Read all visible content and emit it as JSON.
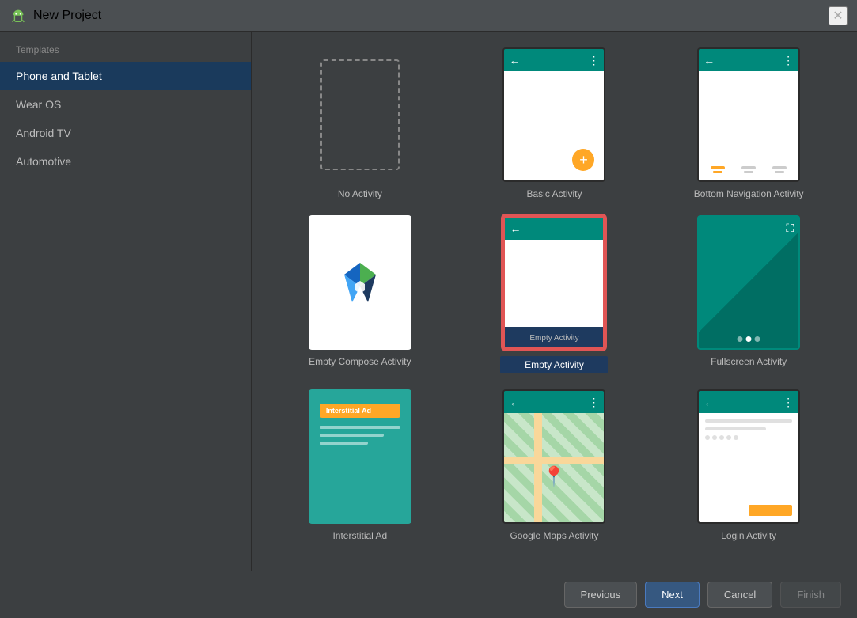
{
  "window": {
    "title": "New Project",
    "close_icon": "✕"
  },
  "sidebar": {
    "section_label": "Templates",
    "items": [
      {
        "id": "phone-tablet",
        "label": "Phone and Tablet",
        "active": true
      },
      {
        "id": "wear-os",
        "label": "Wear OS",
        "active": false
      },
      {
        "id": "android-tv",
        "label": "Android TV",
        "active": false
      },
      {
        "id": "automotive",
        "label": "Automotive",
        "active": false
      }
    ]
  },
  "templates": {
    "items": [
      {
        "id": "no-activity",
        "label": "No Activity",
        "selected": false
      },
      {
        "id": "basic-activity",
        "label": "Basic Activity",
        "selected": false
      },
      {
        "id": "bottom-navigation",
        "label": "Bottom Navigation Activity",
        "selected": false
      },
      {
        "id": "empty-compose",
        "label": "Empty Compose Activity",
        "selected": false
      },
      {
        "id": "empty-activity",
        "label": "Empty Activity",
        "selected": true
      },
      {
        "id": "fullscreen-activity",
        "label": "Fullscreen Activity",
        "selected": false
      },
      {
        "id": "interstitial-ad",
        "label": "Interstitial Ad",
        "selected": false
      },
      {
        "id": "google-maps",
        "label": "Google Maps Activity",
        "selected": false
      },
      {
        "id": "login-activity",
        "label": "Login Activity",
        "selected": false
      }
    ]
  },
  "buttons": {
    "previous": "Previous",
    "next": "Next",
    "cancel": "Cancel",
    "finish": "Finish"
  },
  "icons": {
    "back_arrow": "←",
    "more_vert": "⋮",
    "add": "+",
    "expand": "⛶",
    "map_pin": "📍"
  }
}
